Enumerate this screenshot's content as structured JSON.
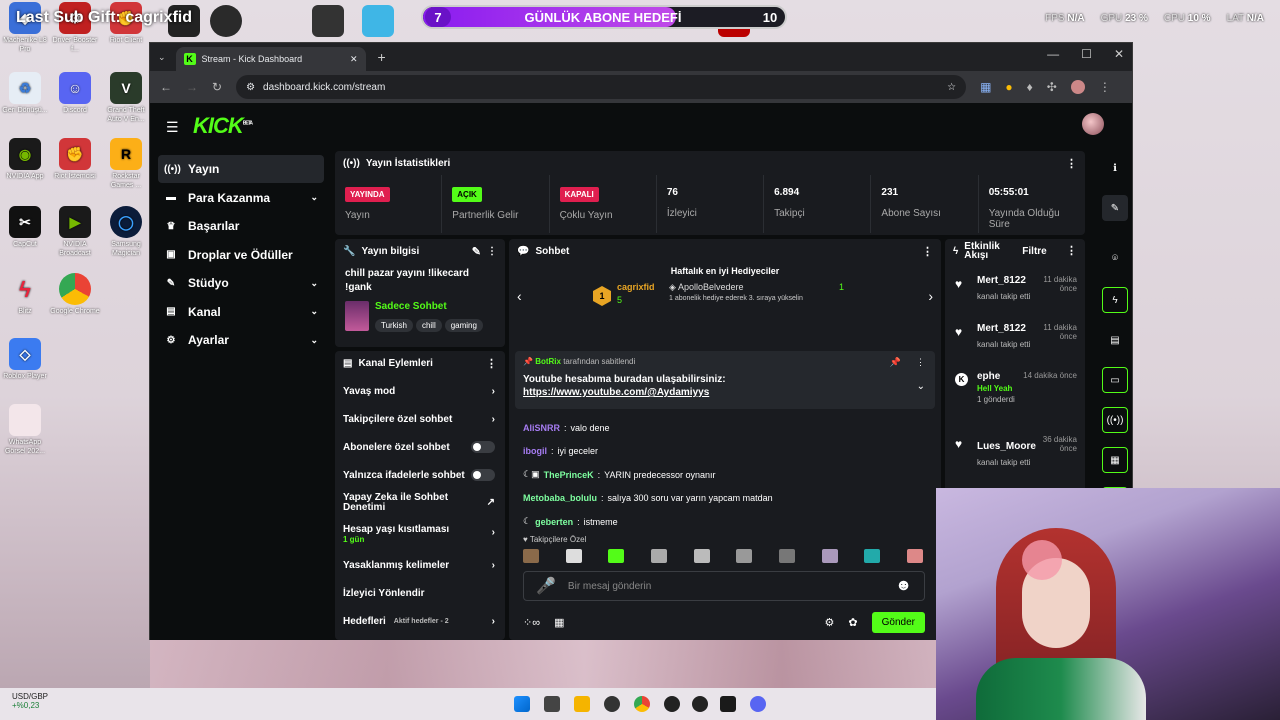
{
  "overlay": {
    "sub_text": "Last Sub Gift: cagrixfid",
    "goal_number": "7",
    "goal_title": "GÜNLÜK ABONE HEDEFİ",
    "goal_target": "10",
    "goal_progress": 0.7
  },
  "sysstats": [
    {
      "label": "FPS",
      "value": "N/A"
    },
    {
      "label": "GPU",
      "value": "23 %"
    },
    {
      "label": "CPU",
      "value": "10 %"
    },
    {
      "label": "LAT",
      "value": "N/A"
    }
  ],
  "desktop_icons": [
    "Machenike L8 Pro",
    "Driver Booster f...",
    "Riot Client",
    "Geri Dönüşü...",
    "Discord",
    "Grand Theft Auto V En...",
    "NVIDIA App",
    "Riot İstemcisi",
    "Rockstar Games ...",
    "CapCut",
    "NVIDIA Broadcast",
    "Samsung Magician",
    "Blitz",
    "Google Chrome",
    "Roblox Player",
    "WhatsApp Görsel 202..."
  ],
  "browser": {
    "tab_title": "Stream - Kick Dashboard",
    "url": "dashboard.kick.com/stream",
    "new_tab": "+",
    "minimize": "—",
    "maximize": "☐",
    "close": "✕"
  },
  "kick": {
    "logo": "KICK",
    "beta": "BETA",
    "nav": [
      {
        "label": "Yayın",
        "icon": "((•))",
        "chev": ""
      },
      {
        "label": "Para Kazanma",
        "icon": "▬",
        "chev": "⌄"
      },
      {
        "label": "Başarılar",
        "icon": "♛",
        "chev": ""
      },
      {
        "label": "Droplar ve Ödüller",
        "icon": "▣",
        "chev": ""
      },
      {
        "label": "Stüdyo",
        "icon": "✎",
        "chev": "⌄"
      },
      {
        "label": "Kanal",
        "icon": "▤",
        "chev": "⌄"
      },
      {
        "label": "Ayarlar",
        "icon": "⚙",
        "chev": "⌄"
      }
    ],
    "stats_title": "Yayın İstatistikleri",
    "stats": [
      {
        "badge": "YAYINDA",
        "label": "Yayın",
        "kind": "red"
      },
      {
        "badge": "AÇIK",
        "label": "Partnerlik Gelir",
        "kind": "green"
      },
      {
        "badge": "KAPALI",
        "label": "Çoklu Yayın",
        "kind": "red"
      },
      {
        "value": "76",
        "label": "İzleyici"
      },
      {
        "value": "6.894",
        "label": "Takipçi"
      },
      {
        "value": "231",
        "label": "Abone Sayısı"
      },
      {
        "value": "05:55:01",
        "label": "Yayında Olduğu Süre"
      }
    ],
    "info": {
      "title": "Yayın bilgisi",
      "stream_title": "chill pazar yayını !likecard !gank",
      "category": "Sadece Sohbet",
      "tags": [
        "Turkish",
        "chill",
        "gaming"
      ]
    },
    "actions": {
      "title": "Kanal Eylemleri",
      "items": [
        {
          "label": "Yavaş mod",
          "type": "arrow"
        },
        {
          "label": "Takipçilere özel sohbet",
          "type": "arrow"
        },
        {
          "label": "Abonelere özel sohbet",
          "type": "toggle"
        },
        {
          "label": "Yalnızca ifadelerle sohbet",
          "type": "toggle"
        },
        {
          "label": "Yapay Zeka ile Sohbet Denetimi",
          "type": "ext"
        },
        {
          "label": "Hesap yaşı kısıtlaması",
          "sub": "1 gün",
          "type": "arrow"
        },
        {
          "label": "Yasaklanmış kelimeler",
          "type": "arrow"
        },
        {
          "label": "İzleyici Yönlendir",
          "type": "none"
        },
        {
          "label": "Hedefleri",
          "sub": "Aktif hedefler - 2",
          "type": "arrow"
        }
      ]
    },
    "chat": {
      "title": "Sohbet",
      "gifters_title": "Haftalık en iyi Hediyeciler",
      "gifter1": {
        "name": "cagrixfid",
        "count": "5",
        "rank": "1"
      },
      "gifter2": {
        "name": "ApolloBelvedere",
        "count": "1",
        "note": "1 abonelik hediye ederek 3. sıraya yükselin"
      },
      "pinned": {
        "by": "BotRix",
        "by_suffix": "tarafından sabitlendi",
        "text": "Youtube hesabıma buradan ulaşabilirsiniz:",
        "link": "https://www.youtube.com/@Aydamiyys"
      },
      "messages": [
        {
          "user": "AliSNRR",
          "color": "#a67cf2",
          "text": "valo dene"
        },
        {
          "user": "ibogil",
          "color": "#a67cf2",
          "text": "iyi geceler"
        },
        {
          "user": "ThePrinceK",
          "color": "#7effa0",
          "text": "YARIN predecessor oynanır"
        },
        {
          "user": "Metobaba_bolulu",
          "color": "#7effa0",
          "text": "salıya 300 soru var yarın yapcam matdan"
        },
        {
          "user": "geberten",
          "color": "#7effa0",
          "text": "istmeme"
        }
      ],
      "followers_only_label": "Takipçilere Özel",
      "placeholder": "Bir mesaj gönderin",
      "send": "Gönder"
    },
    "activity": {
      "title": "Etkinlik Akışı",
      "filter": "Filtre",
      "events": [
        {
          "name": "Mert_8122",
          "time": "11 dakika önce",
          "desc": "kanalı takip etti"
        },
        {
          "name": "Mert_8122",
          "time": "11 dakika önce",
          "desc": "kanalı takip etti"
        },
        {
          "name": "ephe",
          "time": "14 dakika önce",
          "desc": "Hell Yeah",
          "extra": "1 gönderdi"
        },
        {
          "name": "Lues_Moore",
          "time": "36 dakika önce",
          "desc": "kanalı takip etti"
        }
      ]
    }
  },
  "taskbar": {
    "ticker_name": "USD/GBP",
    "ticker_change": "+%0,23"
  }
}
